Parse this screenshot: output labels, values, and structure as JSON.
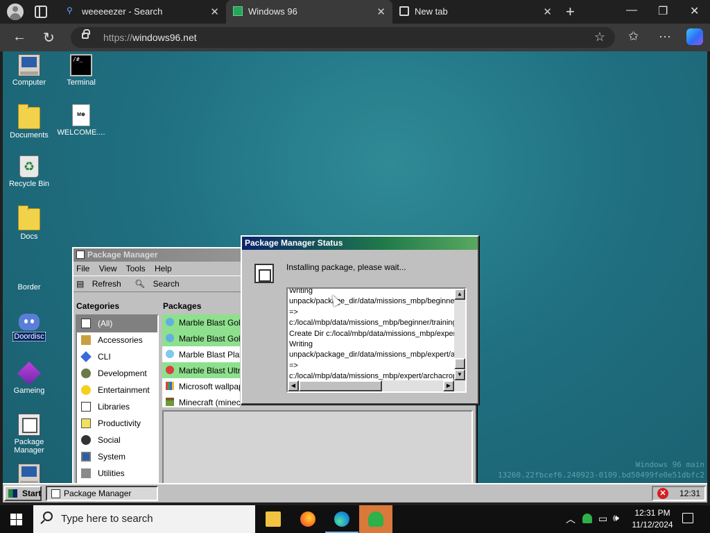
{
  "browser": {
    "tabs": [
      {
        "label": "weeeeezer - Search",
        "active": false
      },
      {
        "label": "Windows 96",
        "active": true
      },
      {
        "label": "New tab",
        "active": false
      }
    ],
    "url_protocol": "https://",
    "url_host": "windows96.net"
  },
  "desktop": {
    "icons": [
      {
        "label": "Computer"
      },
      {
        "label": "Terminal"
      },
      {
        "label": "Documents"
      },
      {
        "label": "WELCOME...."
      },
      {
        "label": "Recycle Bin"
      },
      {
        "label": "Docs"
      },
      {
        "label": "Border"
      },
      {
        "label": "Doordisc"
      },
      {
        "label": "Gameing"
      },
      {
        "label": "Package Manager"
      }
    ],
    "watermark_line1": "Windows 96 main",
    "watermark_line2": "13260.22fbcef6.240923-0109.bd50499fe0e51dbfc2"
  },
  "package_manager": {
    "title": "Package Manager",
    "menu": [
      "File",
      "View",
      "Tools",
      "Help"
    ],
    "toolbar": {
      "refresh": "Refresh",
      "search": "Search"
    },
    "categories_header": "Categories",
    "packages_header": "Packages",
    "categories": [
      "(All)",
      "Accessories",
      "CLI",
      "Development",
      "Entertainment",
      "Libraries",
      "Productivity",
      "Social",
      "System",
      "Utilities"
    ],
    "packages": [
      {
        "label": "Marble Blast Gold (m",
        "highlight": true
      },
      {
        "label": "Marble Blast Gold - L",
        "highlight": true
      },
      {
        "label": "Marble Blast Platinu",
        "highlight": false
      },
      {
        "label": "Marble Blast Ultra (m",
        "highlight": true
      },
      {
        "label": "Microsoft wallpaper",
        "highlight": false
      },
      {
        "label": "Minecraft (minecraf",
        "highlight": false
      }
    ]
  },
  "status_dialog": {
    "title": "Package Manager Status",
    "message": "Installing package, please wait...",
    "log": [
      "Writing",
      "unpack/package_dir/data/missions_mbp/beginner",
      "=>",
      "c:/local/mbp/data/missions_mbp/beginner/training",
      "Create Dir c:/local/mbp/data/missions_mbp/expert",
      "Writing",
      "unpack/package_dir/data/missions_mbp/expert/a",
      "=>",
      "c:/local/mbp/data/missions_mbp/expert/archacrop"
    ]
  },
  "w96_taskbar": {
    "start": "Start",
    "task": "Package Manager",
    "time": "12:31"
  },
  "os_taskbar": {
    "search_placeholder": "Type here to search",
    "time": "12:31 PM",
    "date": "11/12/2024"
  }
}
